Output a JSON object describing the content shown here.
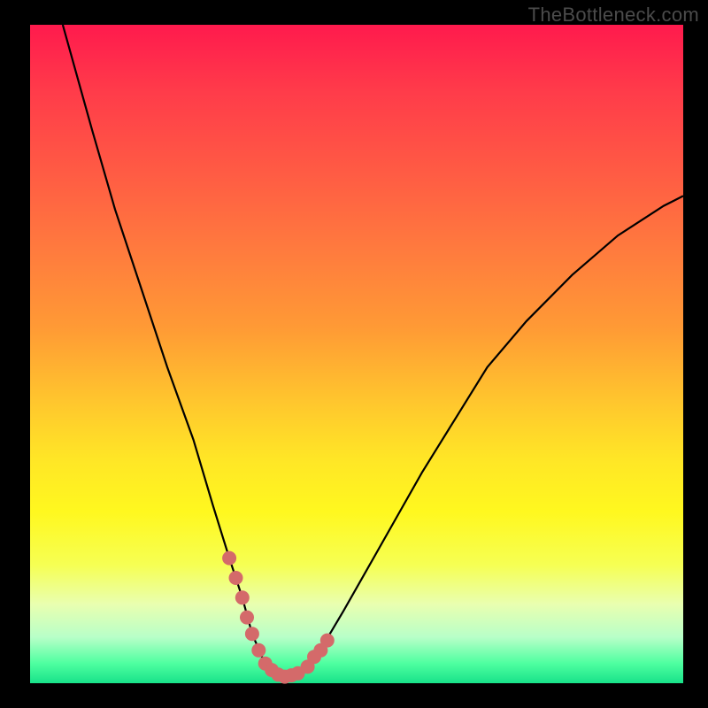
{
  "watermark": "TheBottleneck.com",
  "colors": {
    "frame": "#000000",
    "curve": "#000000",
    "markers": "#d46a6a"
  },
  "chart_data": {
    "type": "line",
    "title": "",
    "xlabel": "",
    "ylabel": "",
    "xlim": [
      0,
      100
    ],
    "ylim": [
      0,
      100
    ],
    "grid": false,
    "legend": false,
    "series": [
      {
        "name": "bottleneck-curve",
        "x": [
          5,
          9.5,
          13,
          17,
          21,
          25,
          28,
          30.5,
          32.5,
          34,
          35.5,
          37,
          39,
          41,
          43,
          45,
          48,
          52,
          56,
          60,
          65,
          70,
          76,
          83,
          90,
          97,
          100
        ],
        "y": [
          100,
          84,
          72,
          60,
          48,
          37,
          27,
          19,
          13,
          7.5,
          4,
          2,
          1,
          1.5,
          3,
          6,
          11,
          18,
          25,
          32,
          40,
          48,
          55,
          62,
          68,
          72.5,
          74
        ]
      }
    ],
    "markers": {
      "name": "highlight-points",
      "x": [
        30.5,
        31.5,
        32.5,
        33.2,
        34,
        35,
        36,
        37,
        38,
        39,
        40,
        41,
        42.5,
        43.5,
        44.5,
        45.5
      ],
      "y": [
        19,
        16,
        13,
        10,
        7.5,
        5,
        3,
        2,
        1.3,
        1,
        1.2,
        1.5,
        2.5,
        4,
        5,
        6.5
      ]
    }
  }
}
